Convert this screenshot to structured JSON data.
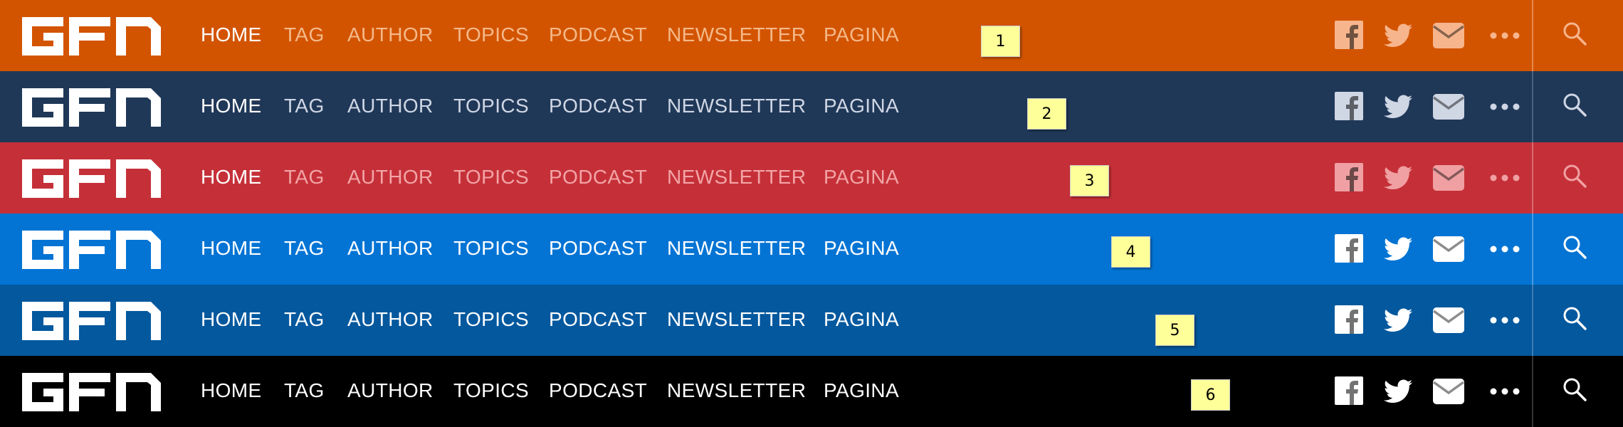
{
  "logo": {
    "text": "GFN"
  },
  "nav": [
    "HOME",
    "TAG",
    "AUTHOR",
    "TOPICS",
    "PODCAST",
    "NEWSLETTER",
    "PAGINA"
  ],
  "social_icons": [
    "facebook-icon",
    "twitter-icon",
    "mail-icon",
    "more-icon"
  ],
  "search_icon": "search-icon",
  "variants": [
    {
      "label": "1",
      "bg": "#d35400",
      "nav_color": "#f4b98a",
      "icon_color": "#f6b58d",
      "divider": "#e58a4f"
    },
    {
      "label": "2",
      "bg": "#203858",
      "nav_color": "#cfd6e4",
      "icon_color": "#cfd6e4",
      "divider": "#4a6180"
    },
    {
      "label": "3",
      "bg": "#c53038",
      "nav_color": "#f2a4a6",
      "icon_color": "#f0a0a3",
      "divider": "#d86a70"
    },
    {
      "label": "4",
      "bg": "#0374d4",
      "nav_color": "#ffffff",
      "icon_color": "#ffffff",
      "divider": "#4a9be0"
    },
    {
      "label": "5",
      "bg": "#03589e",
      "nav_color": "#ffffff",
      "icon_color": "#ffffff",
      "divider": "#3f7db5"
    },
    {
      "label": "6",
      "bg": "#000000",
      "nav_color": "#ffffff",
      "icon_color": "#ffffff",
      "divider": "#333333"
    }
  ]
}
